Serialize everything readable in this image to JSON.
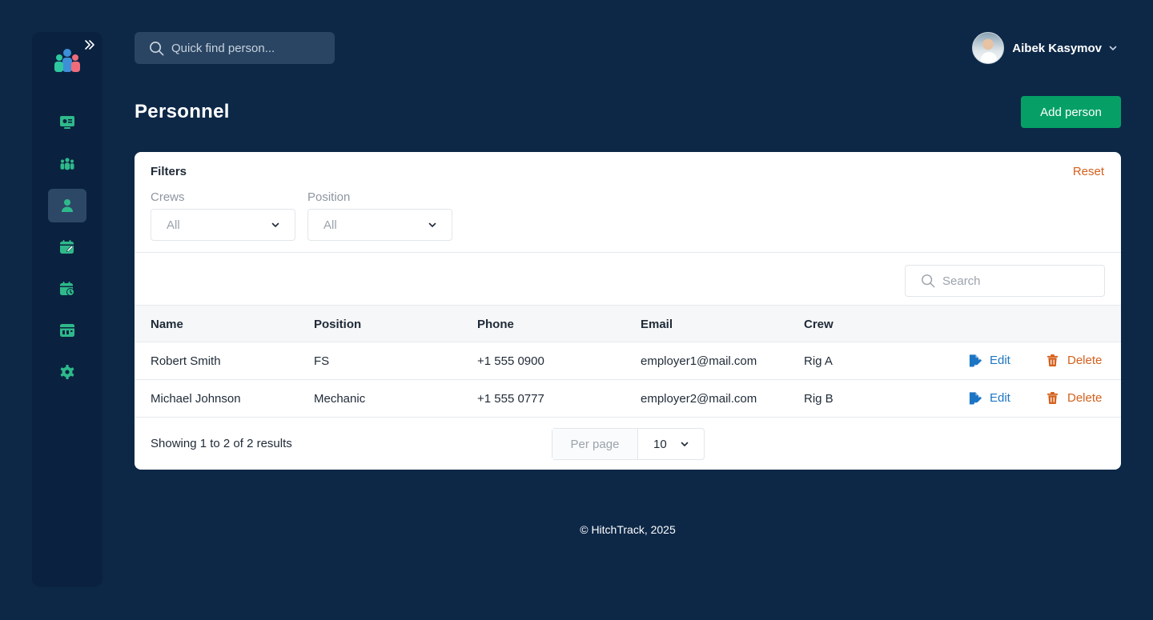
{
  "colors": {
    "background": "#0d2847",
    "sidebar": "#0a2240",
    "accent_green": "#06a067",
    "icon_green": "#2fb98a",
    "edit_blue": "#1c75c4",
    "delete_orange": "#d4601c"
  },
  "sidebar": {
    "items": [
      {
        "icon": "monitor-icon",
        "active": false
      },
      {
        "icon": "team-icon",
        "active": false
      },
      {
        "icon": "person-icon",
        "active": true
      },
      {
        "icon": "calendar-edit-icon",
        "active": false
      },
      {
        "icon": "calendar-clock-icon",
        "active": false
      },
      {
        "icon": "dashboard-icon",
        "active": false
      },
      {
        "icon": "gear-icon",
        "active": false
      }
    ]
  },
  "header": {
    "search_placeholder": "Quick find person...",
    "user_name": "Aibek Kasymov"
  },
  "page": {
    "title": "Personnel",
    "add_button": "Add person"
  },
  "filters": {
    "title": "Filters",
    "reset": "Reset",
    "crews_label": "Crews",
    "crews_value": "All",
    "position_label": "Position",
    "position_value": "All"
  },
  "table": {
    "search_placeholder": "Search",
    "columns": [
      "Name",
      "Position",
      "Phone",
      "Email",
      "Crew"
    ],
    "rows": [
      {
        "name": "Robert Smith",
        "position": "FS",
        "phone": "+1 555 0900",
        "email": "employer1@mail.com",
        "crew": "Rig A"
      },
      {
        "name": "Michael Johnson",
        "position": "Mechanic",
        "phone": "+1 555 0777",
        "email": "employer2@mail.com",
        "crew": "Rig B"
      }
    ],
    "edit_label": "Edit",
    "delete_label": "Delete"
  },
  "pagination": {
    "showing": "Showing 1 to 2 of 2 results",
    "per_page_label": "Per page",
    "per_page_value": "10"
  },
  "footer": "© HitchTrack, 2025"
}
